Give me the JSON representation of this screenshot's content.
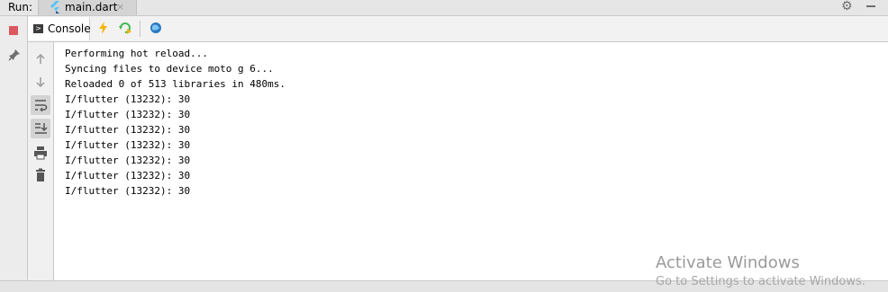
{
  "run_bar": {
    "label": "Run:",
    "tab_title": "main.dart",
    "tab_close": "×"
  },
  "console_tab": {
    "label": "Console"
  },
  "console_lines": [
    "Performing hot reload...",
    "Syncing files to device moto g 6...",
    "Reloaded 0 of 513 libraries in 480ms.",
    "I/flutter (13232): 30",
    "I/flutter (13232): 30",
    "I/flutter (13232): 30",
    "I/flutter (13232): 30",
    "I/flutter (13232): 30",
    "I/flutter (13232): 30",
    "I/flutter (13232): 30"
  ],
  "watermark": {
    "title": "Activate Windows",
    "subtitle": "Go to Settings to activate Windows."
  },
  "colors": {
    "stop": "#db5860",
    "hot_reload": "#f4b400",
    "restart": "#3fb950",
    "dart_devtools": "#2b79c2"
  }
}
